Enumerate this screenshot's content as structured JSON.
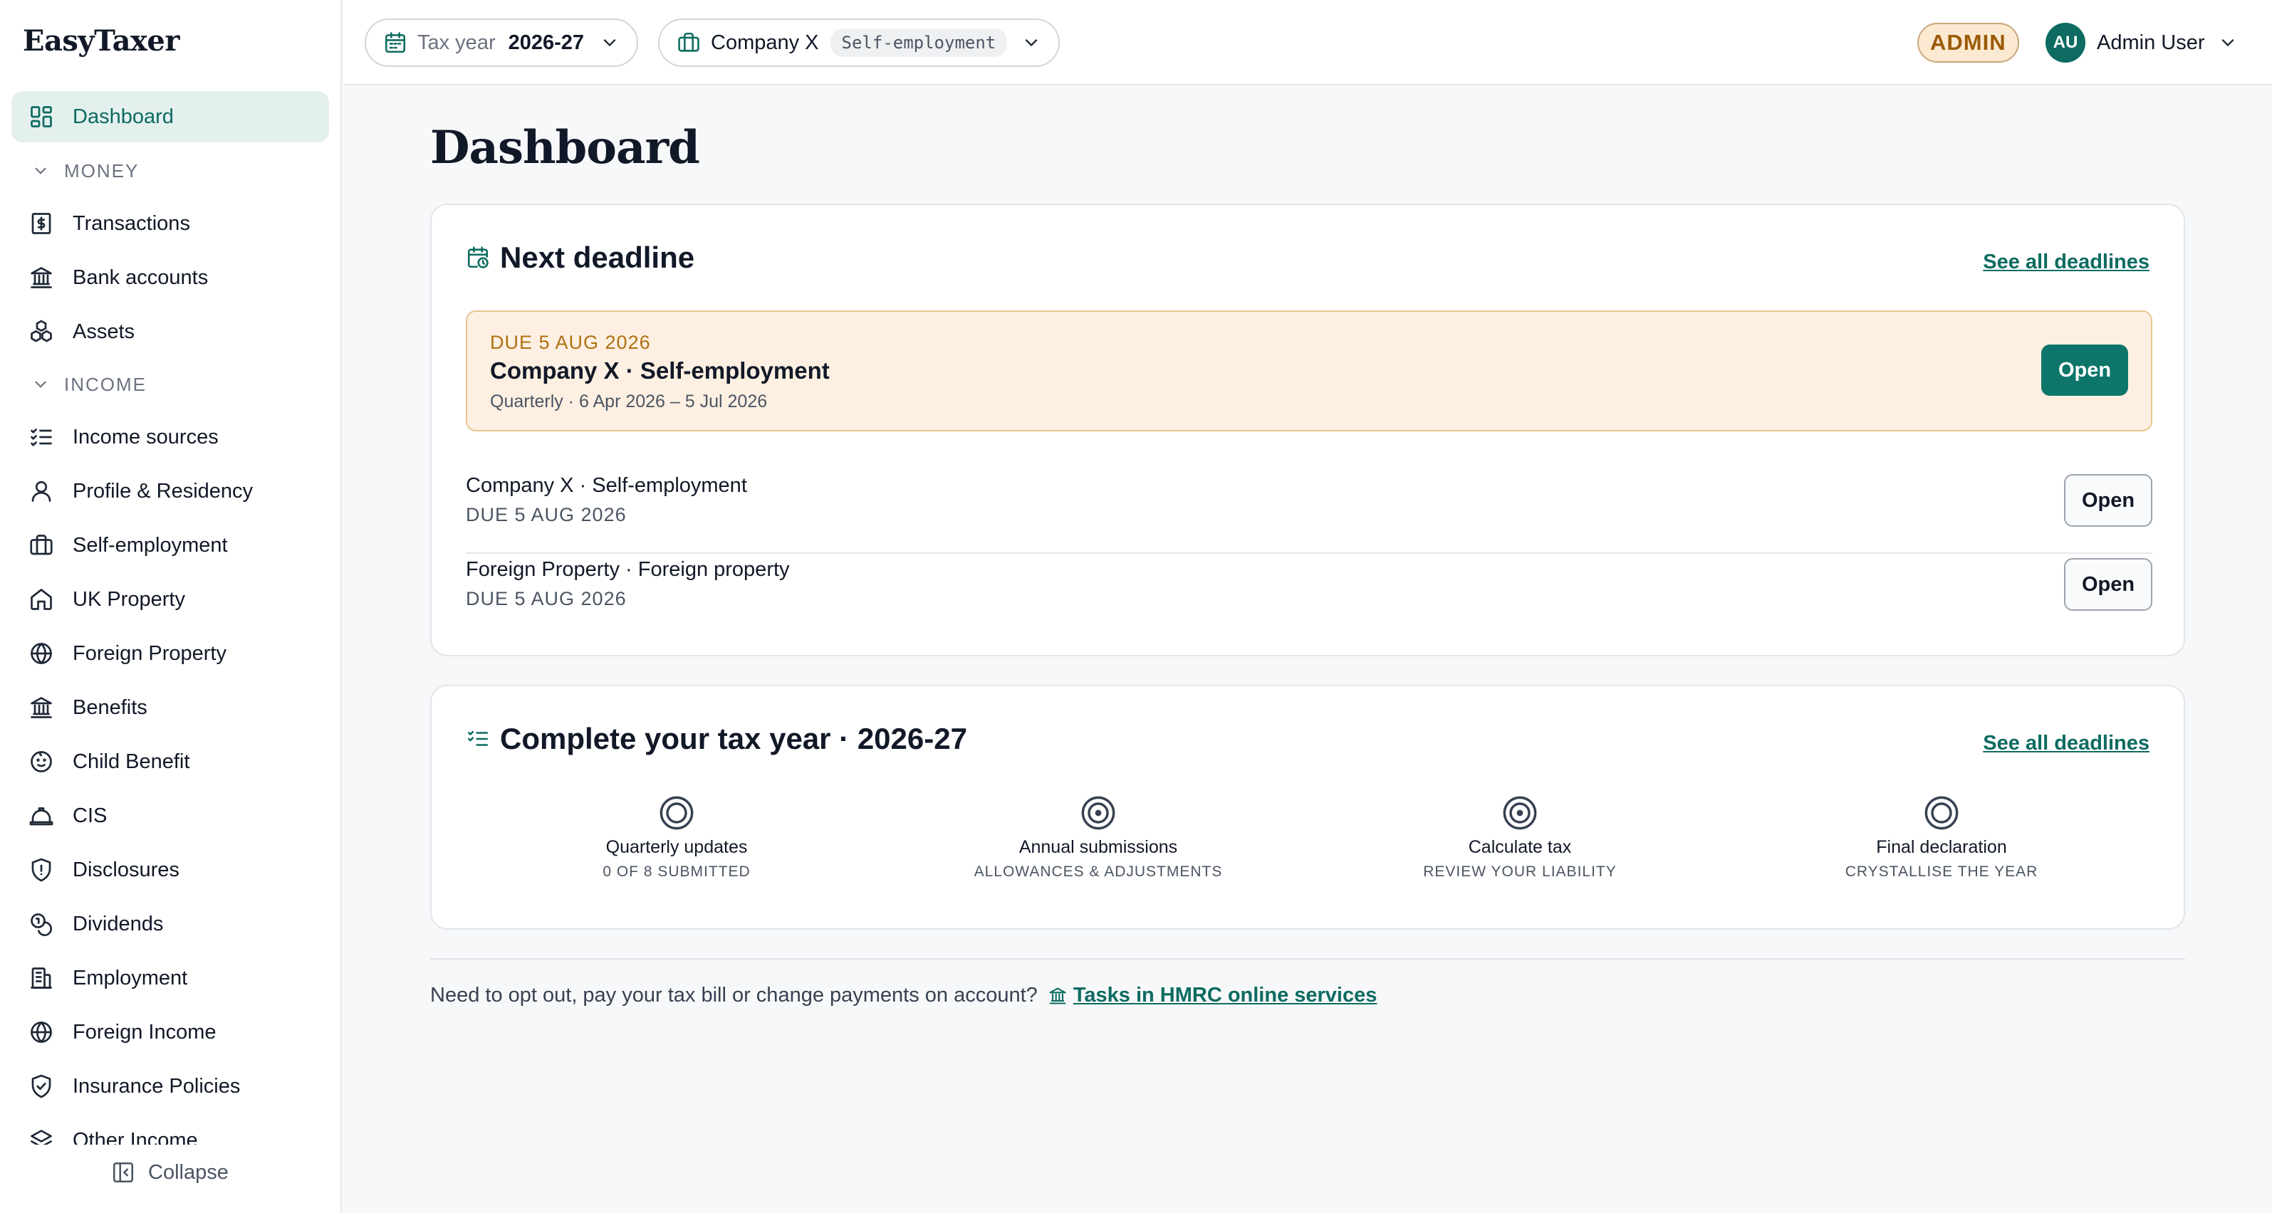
{
  "app": {
    "brand": "EasyTaxer"
  },
  "sidebar": {
    "dashboard": "Dashboard",
    "money_section": "MONEY",
    "money_items": [
      {
        "label": "Transactions",
        "icon": "dollar-document-icon"
      },
      {
        "label": "Bank accounts",
        "icon": "bank-icon"
      },
      {
        "label": "Assets",
        "icon": "assets-icon"
      }
    ],
    "income_section": "INCOME",
    "income_items": [
      {
        "label": "Income sources",
        "icon": "checklist-icon"
      },
      {
        "label": "Profile & Residency",
        "icon": "user-icon"
      },
      {
        "label": "Self-employment",
        "icon": "briefcase-icon"
      },
      {
        "label": "UK Property",
        "icon": "home-icon"
      },
      {
        "label": "Foreign Property",
        "icon": "globe-icon"
      },
      {
        "label": "Benefits",
        "icon": "bank-icon"
      },
      {
        "label": "Child Benefit",
        "icon": "baby-icon"
      },
      {
        "label": "CIS",
        "icon": "hard-hat-icon"
      },
      {
        "label": "Disclosures",
        "icon": "shield-alert-icon"
      },
      {
        "label": "Dividends",
        "icon": "coins-icon"
      },
      {
        "label": "Employment",
        "icon": "building-icon"
      },
      {
        "label": "Foreign Income",
        "icon": "globe-icon"
      },
      {
        "label": "Insurance Policies",
        "icon": "shield-check-icon"
      },
      {
        "label": "Other Income",
        "icon": "layers-icon"
      }
    ],
    "collapse": "Collapse"
  },
  "topbar": {
    "tax_year_label": "Tax year",
    "tax_year_value": "2026-27",
    "company_name": "Company X",
    "company_tag": "Self-employment",
    "admin_badge": "ADMIN",
    "avatar_initials": "AU",
    "user_name": "Admin User"
  },
  "main": {
    "title": "Dashboard",
    "next_deadline": {
      "heading": "Next deadline",
      "link": "See all deadlines",
      "highlight": {
        "due": "DUE 5 AUG 2026",
        "title": "Company X · Self-employment",
        "subtitle": "Quarterly · 6 Apr 2026 – 5 Jul 2026",
        "button": "Open"
      },
      "rows": [
        {
          "title": "Company X · Self-employment",
          "due": "DUE 5 AUG 2026",
          "button": "Open"
        },
        {
          "title": "Foreign Property · Foreign property",
          "due": "DUE 5 AUG 2026",
          "button": "Open"
        }
      ]
    },
    "tax_year_card": {
      "heading": "Complete your tax year · 2026-27",
      "link": "See all deadlines",
      "steps": [
        {
          "title": "Quarterly updates",
          "subtitle": "0 OF 8 SUBMITTED",
          "icon": "circle-icon"
        },
        {
          "title": "Annual submissions",
          "subtitle": "ALLOWANCES & ADJUSTMENTS",
          "icon": "circle-dot-icon"
        },
        {
          "title": "Calculate tax",
          "subtitle": "REVIEW YOUR LIABILITY",
          "icon": "circle-dot-icon"
        },
        {
          "title": "Final declaration",
          "subtitle": "CRYSTALLISE THE YEAR",
          "icon": "circle-icon"
        }
      ]
    },
    "footer": {
      "text": "Need to opt out, pay your tax bill or change payments on account?",
      "link": "Tasks in HMRC online services"
    }
  },
  "colors": {
    "accent": "#0d6b61",
    "highlight_bg": "#fdf0e2",
    "due_text": "#b06f0f",
    "admin_bg": "#fbe9d2"
  }
}
